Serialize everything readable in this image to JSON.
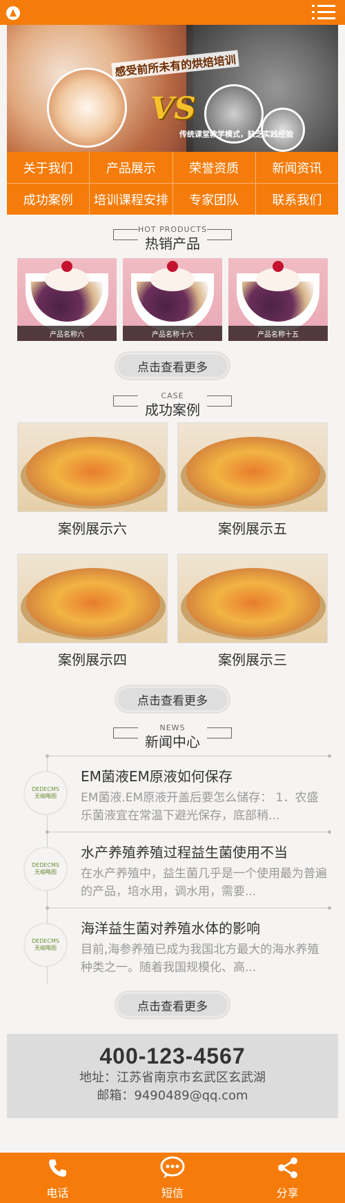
{
  "header": {
    "logo_icon": "logo-icon",
    "menu_icon": "menu-icon"
  },
  "banner": {
    "headline": "感受前所未有的烘焙培训",
    "vs": "VS",
    "sub": "传统课堂教学模式，缺乏实践经验"
  },
  "nav": [
    "关于我们",
    "产品展示",
    "荣誉资质",
    "新闻资讯",
    "成功案例",
    "培训课程安排",
    "专家团队",
    "联系我们"
  ],
  "hot_products": {
    "en": "HOT PRODUCTS",
    "zh": "热销产品",
    "items": [
      "产品名称六",
      "产品名称十六",
      "产品名称十五"
    ],
    "more": "点击查看更多"
  },
  "cases": {
    "en": "CASE",
    "zh": "成功案例",
    "items": [
      "案例展示六",
      "案例展示五",
      "案例展示四",
      "案例展示三"
    ],
    "more": "点击查看更多"
  },
  "news": {
    "en": "NEWS",
    "zh": "新闻中心",
    "thumb_line1": "DEDECMS",
    "thumb_line2": "无缩略图",
    "items": [
      {
        "title": "EM菌液EM原液如何保存",
        "desc": "EM菌液.EM原液开盖后要怎么储存： 1．农盛乐菌液宜在常温下避光保存，底部稍..."
      },
      {
        "title": "水产养殖养殖过程益生菌使用不当",
        "desc": "在水产养殖中，益生菌几乎是一个使用最为普遍的产品，培水用，调水用，需要..."
      },
      {
        "title": "海洋益生菌对养殖水体的影响",
        "desc": "目前,海参养殖已成为我国北方最大的海水养殖种类之一。随着我国规模化、高..."
      }
    ],
    "more": "点击查看更多"
  },
  "contact": {
    "phone": "400-123-4567",
    "address": "地址：江苏省南京市玄武区玄武湖",
    "email": "邮箱：9490489@qq.com"
  },
  "footer": {
    "items": [
      {
        "label": "电话",
        "icon": "phone-icon"
      },
      {
        "label": "短信",
        "icon": "message-icon"
      },
      {
        "label": "分享",
        "icon": "share-icon"
      }
    ]
  },
  "colors": {
    "accent": "#f57c0a",
    "bg": "#f6f4f2"
  }
}
